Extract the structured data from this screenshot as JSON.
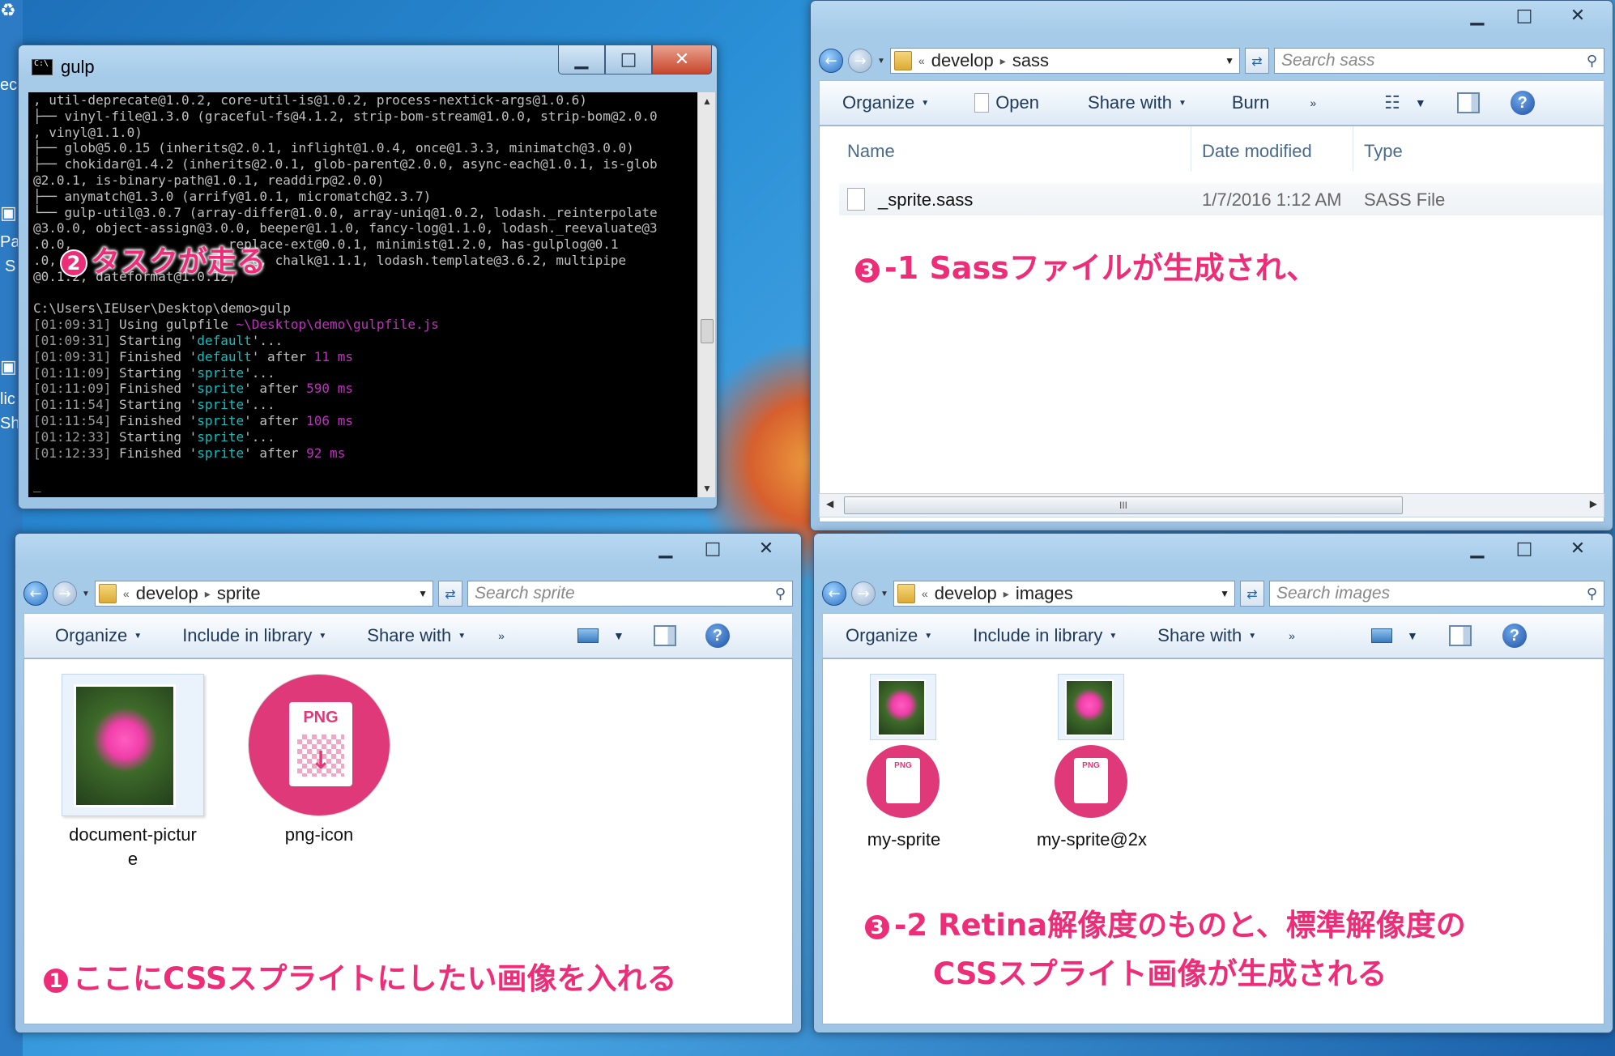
{
  "console": {
    "title": "gulp",
    "lines": [
      [
        [
          ", util-deprecate@1.0.2, core-util-is@1.0.2, process-nextick-args@1.0.6)",
          "t"
        ]
      ],
      [
        [
          "├── vinyl-file@1.3.0 (graceful-fs@4.1.2, strip-bom-stream@1.0.0, strip-bom@2.0.0",
          "t"
        ]
      ],
      [
        [
          ", vinyl@1.1.0)",
          "t"
        ]
      ],
      [
        [
          "├── glob@5.0.15 (inherits@2.0.1, inflight@1.0.4, once@1.3.3, minimatch@3.0.0)",
          "t"
        ]
      ],
      [
        [
          "├── chokidar@1.4.2 (inherits@2.0.1, glob-parent@2.0.0, async-each@1.0.1, is-glob",
          "t"
        ]
      ],
      [
        [
          "@2.0.1, is-binary-path@1.0.1, readdirp@2.0.0)",
          "t"
        ]
      ],
      [
        [
          "├── anymatch@1.3.0 (arrify@1.0.1, micromatch@2.3.7)",
          "t"
        ]
      ],
      [
        [
          "└── gulp-util@3.0.7 (array-differ@1.0.0, array-uniq@1.0.2, lodash._reinterpolate",
          "t"
        ]
      ],
      [
        [
          "@3.0.0, object-assign@3.0.0, beeper@1.1.0, fancy-log@1.1.0, lodash._reevaluate@3",
          "t"
        ]
      ],
      [
        [
          ".0.0, ",
          "t"
        ],
        [
          "                   ",
          "t"
        ],
        [
          "replace-ext@0.0.1, minimist@1.2.0, has-gulplog@0.1",
          "t"
        ]
      ],
      [
        [
          ".0, ",
          "t"
        ],
        [
          "                        ",
          "t"
        ],
        [
          "0, chalk@1.1.1, lodash.template@3.6.2, multipipe",
          "t"
        ]
      ],
      [
        [
          "@0.1.2, dateformat@1.0.12)",
          "t"
        ]
      ],
      [
        [
          "",
          "t"
        ]
      ],
      [
        [
          "C:\\Users\\IEUser\\Desktop\\demo>gulp",
          "t"
        ]
      ],
      [
        [
          "[01:09:31]",
          "tg"
        ],
        [
          " Using gulpfile ",
          "t"
        ],
        [
          "~\\Desktop\\demo\\gulpfile.js",
          "tm"
        ]
      ],
      [
        [
          "[01:09:31]",
          "tg"
        ],
        [
          " Starting '",
          "t"
        ],
        [
          "default",
          "tc"
        ],
        [
          "'...",
          "t"
        ]
      ],
      [
        [
          "[01:09:31]",
          "tg"
        ],
        [
          " Finished '",
          "t"
        ],
        [
          "default",
          "tc"
        ],
        [
          "' after ",
          "t"
        ],
        [
          "11 ms",
          "tm"
        ]
      ],
      [
        [
          "[01:11:09]",
          "tg"
        ],
        [
          " Starting '",
          "t"
        ],
        [
          "sprite",
          "tc"
        ],
        [
          "'...",
          "t"
        ]
      ],
      [
        [
          "[01:11:09]",
          "tg"
        ],
        [
          " Finished '",
          "t"
        ],
        [
          "sprite",
          "tc"
        ],
        [
          "' after ",
          "t"
        ],
        [
          "590 ms",
          "tm"
        ]
      ],
      [
        [
          "[01:11:54]",
          "tg"
        ],
        [
          " Starting '",
          "t"
        ],
        [
          "sprite",
          "tc"
        ],
        [
          "'...",
          "t"
        ]
      ],
      [
        [
          "[01:11:54]",
          "tg"
        ],
        [
          " Finished '",
          "t"
        ],
        [
          "sprite",
          "tc"
        ],
        [
          "' after ",
          "t"
        ],
        [
          "106 ms",
          "tm"
        ]
      ],
      [
        [
          "[01:12:33]",
          "tg"
        ],
        [
          " Starting '",
          "t"
        ],
        [
          "sprite",
          "tc"
        ],
        [
          "'...",
          "t"
        ]
      ],
      [
        [
          "[01:12:33]",
          "tg"
        ],
        [
          " Finished '",
          "t"
        ],
        [
          "sprite",
          "tc"
        ],
        [
          "' after ",
          "t"
        ],
        [
          "92 ms",
          "tm"
        ]
      ],
      [
        [
          "",
          "t"
        ]
      ],
      [
        [
          "_",
          "t"
        ]
      ]
    ]
  },
  "sass_window": {
    "path_root": "develop",
    "path_current": "sass",
    "search_placeholder": "Search sass",
    "commands": {
      "organize": "Organize",
      "open": "Open",
      "share_with": "Share with",
      "burn": "Burn",
      "more": "»"
    },
    "columns": {
      "name": "Name",
      "date_modified": "Date modified",
      "type": "Type"
    },
    "file": {
      "name": "_sprite.sass",
      "date": "1/7/2016 1:12 AM",
      "type": "SASS File"
    },
    "scroll_grip": "III"
  },
  "sprite_window": {
    "path_root": "develop",
    "path_current": "sprite",
    "search_placeholder": "Search sprite",
    "commands": {
      "organize": "Organize",
      "include": "Include in library",
      "share_with": "Share with",
      "more": "»"
    },
    "files": [
      {
        "name_line1": "document-pictur",
        "name_line2": "e"
      },
      {
        "name_line1": "png-icon",
        "name_line2": ""
      }
    ]
  },
  "images_window": {
    "path_root": "develop",
    "path_current": "images",
    "search_placeholder": "Search images",
    "commands": {
      "organize": "Organize",
      "include": "Include in library",
      "share_with": "Share with",
      "more": "»"
    },
    "files": [
      {
        "name": "my-sprite"
      },
      {
        "name": "my-sprite@2x"
      }
    ]
  },
  "annotations": {
    "a1_badge": "1",
    "a1_text": "ここにCSSスプライトにしたい画像を入れる",
    "a2_badge": "2",
    "a2_text": "タスクが走る",
    "a3_1_badge": "3",
    "a3_1_text": "-1 Sassファイルが生成され、",
    "a3_2_badge": "3",
    "a3_2_line1": "-2 Retina解像度のものと、標準解像度の",
    "a3_2_line2": "CSSスプライト画像が生成される"
  },
  "desktop": {
    "partial_labels": [
      "ec",
      "Pa",
      "S",
      "lic",
      "Sh"
    ]
  },
  "icons": {
    "png_label": "PNG",
    "caption_min": "▁",
    "caption_max": "□",
    "caption_close": "✕"
  },
  "colors": {
    "annotation": "#ee2d78",
    "png_icon": "#e0397a",
    "console_cyan": "#0fbfbf",
    "console_magenta": "#c030c0"
  }
}
